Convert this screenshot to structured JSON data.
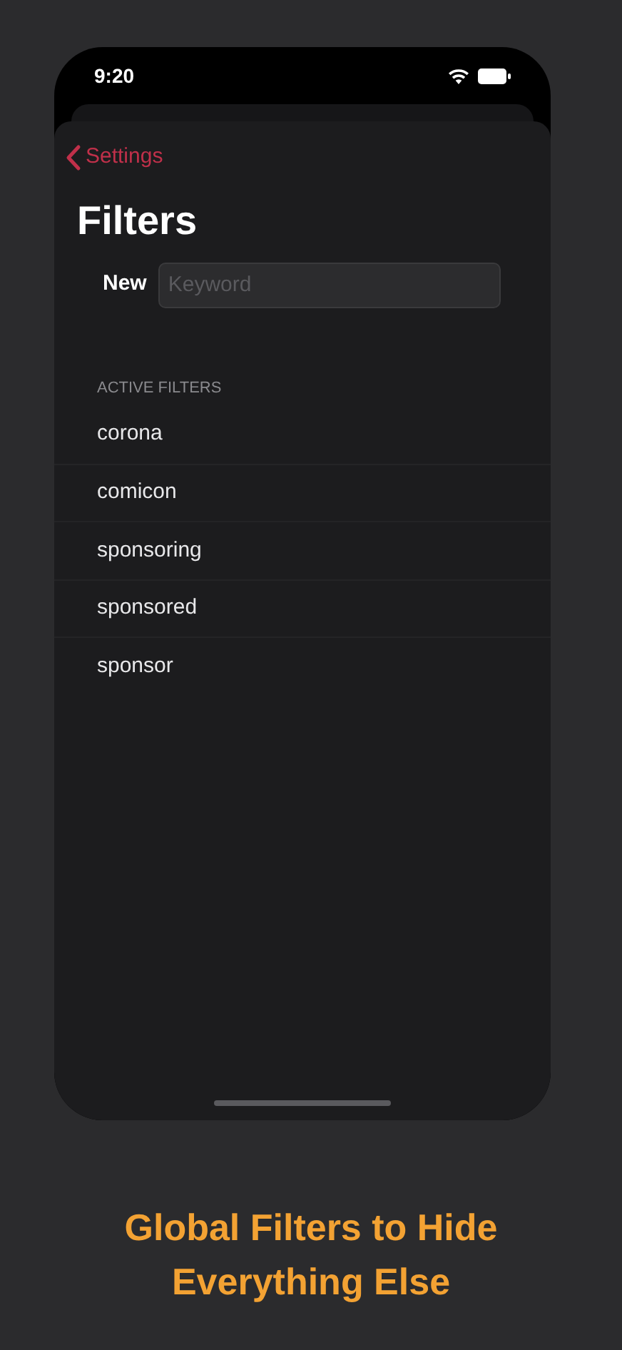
{
  "status_bar": {
    "time": "9:20"
  },
  "nav": {
    "back": "Settings",
    "title": "Filters"
  },
  "new_keyword": {
    "label": "New",
    "placeholder": "Keyword"
  },
  "active_filters": {
    "header": "ACTIVE FILTERS",
    "items": [
      "corona",
      "comicon",
      "sponsoring",
      "sponsored",
      "sponsor"
    ]
  },
  "caption": "Global Filters to Hide Everything Else"
}
